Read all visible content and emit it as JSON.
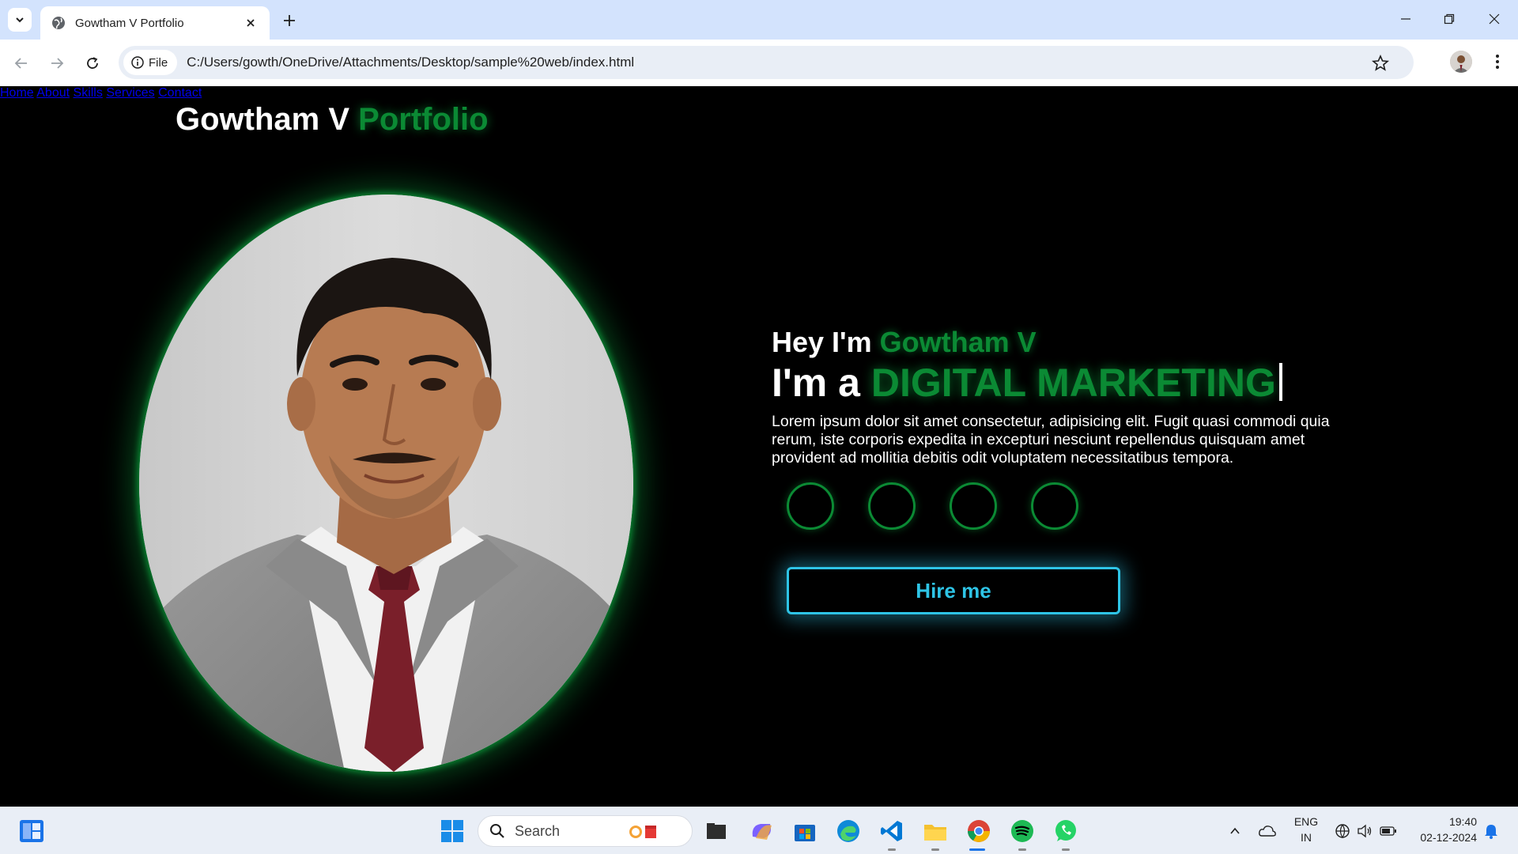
{
  "browser": {
    "tab_title": "Gowtham V Portfolio",
    "chip_label": "File",
    "url": "C:/Users/gowth/OneDrive/Attachments/Desktop/sample%20web/index.html"
  },
  "page": {
    "logo_main": "Gowtham V ",
    "logo_accent": "Portfolio",
    "nav": [
      {
        "label": "Home"
      },
      {
        "label": "About"
      },
      {
        "label": "Skills"
      },
      {
        "label": "Services"
      },
      {
        "label": "Contact"
      }
    ],
    "hero": {
      "greeting": "Hey I'm ",
      "name": "Gowtham V",
      "role_prefix": "I'm a ",
      "role": "DIGITAL MARKETING",
      "description": "Lorem ipsum dolor sit amet consectetur, adipisicing elit. Fugit quasi commodi quia rerum, iste corporis expedita in excepturi nesciunt repellendus quisquam amet provident ad mollitia debitis odit voluptatem necessitatibus tempora.",
      "hire_label": "Hire me"
    },
    "colors": {
      "accent": "#0b8a34",
      "button": "#2ec4e6",
      "background": "#000000"
    }
  },
  "taskbar": {
    "search_placeholder": "Search",
    "lang_top": "ENG",
    "lang_bottom": "IN",
    "time": "19:40",
    "date": "02-12-2024",
    "apps": [
      "widgets-icon",
      "start-icon",
      "file-explorer-task-icon",
      "copilot-icon",
      "store-icon",
      "edge-icon",
      "vscode-icon",
      "folder-icon",
      "chrome-icon",
      "spotify-icon",
      "whatsapp-icon"
    ]
  }
}
